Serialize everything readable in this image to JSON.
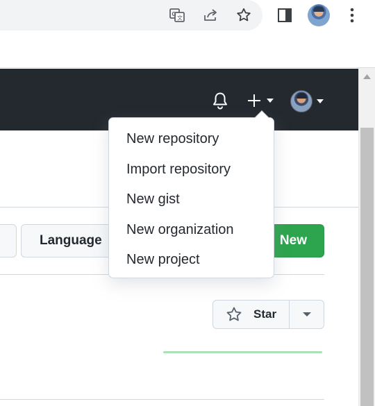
{
  "browser": {
    "icons": [
      "google-translate-icon",
      "share-icon",
      "bookmark-star-icon",
      "side-panel-icon",
      "profile-avatar",
      "more-vertical-icon"
    ]
  },
  "header": {
    "icons": [
      "notifications-bell-icon",
      "create-new-plus-icon",
      "user-avatar"
    ]
  },
  "toolbar": {
    "language_label": "Language",
    "new_label": "New"
  },
  "create_menu": {
    "items": [
      {
        "label": "New repository"
      },
      {
        "label": "Import repository"
      },
      {
        "label": "New gist"
      },
      {
        "label": "New organization"
      },
      {
        "label": "New project"
      }
    ]
  },
  "repo": {
    "star_label": "Star"
  },
  "colors": {
    "header_bg": "#24292f",
    "primary_green": "#2da44e",
    "border": "#d0d7de"
  }
}
